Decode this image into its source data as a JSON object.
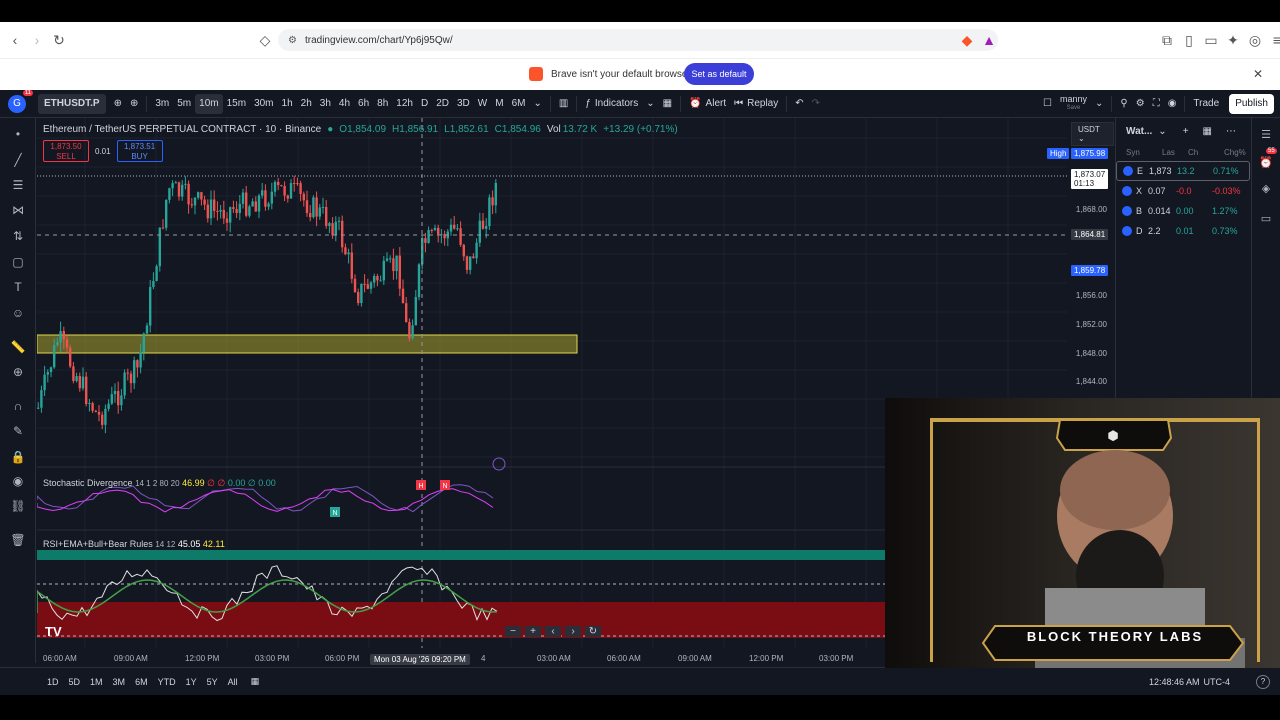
{
  "browser": {
    "url": "tradingview.com/chart/Yp6j95Qw/",
    "banner_message": "Brave isn't your default browser",
    "banner_button": "Set as default"
  },
  "toolbar": {
    "avatar_letter": "G",
    "avatar_badge": "11",
    "symbol": "ETHUSDT.P",
    "intervals": [
      "3m",
      "5m",
      "10m",
      "15m",
      "30m",
      "1h",
      "2h",
      "3h",
      "4h",
      "6h",
      "8h",
      "12h",
      "D",
      "2D",
      "3D",
      "W",
      "M",
      "6M"
    ],
    "active_interval": "10m",
    "indicators": "Indicators",
    "alert": "Alert",
    "replay": "Replay",
    "layout_name": "manny",
    "layout_sub": "Save",
    "trade": "Trade",
    "publish": "Publish"
  },
  "chart": {
    "title": "Ethereum / TetherUS PERPETUAL CONTRACT · 10 · Binance",
    "o": "O1,854.09",
    "h": "H1,856.91",
    "l": "L1,852.61",
    "c": "C1,854.96",
    "vol": "Vol",
    "vol_value": "13.72 K",
    "change": "+13.29 (+0.71%)",
    "sell_price": "1,873.50",
    "sell_label": "SELL",
    "spread": "0.01",
    "buy_price": "1,873.51",
    "buy_label": "BUY",
    "currency": "USDT",
    "high_label": "High",
    "high_value": "1,875.98",
    "last_price": "1,873.07",
    "countdown": "01:13",
    "crosshair_price": "1,864.81",
    "blue_price": "1,859.78",
    "price_ticks": [
      "1,868.00",
      "1,856.00",
      "1,852.00",
      "1,848.00",
      "1,844.00"
    ],
    "time_ticks": [
      "06:00 AM",
      "09:00 AM",
      "12:00 PM",
      "03:00 PM",
      "06:00 PM",
      "4",
      "03:00 AM",
      "06:00 AM",
      "09:00 AM",
      "12:00 PM",
      "03:00 PM"
    ],
    "crosshair_time": "Mon 03 Aug '26   09:20 PM",
    "colors": {
      "up": "#26a69a",
      "down": "#ef5350",
      "zone": "#a7a12a",
      "rsi_upper": "#0d7a6a",
      "rsi_lower": "#7a0d14"
    }
  },
  "stoch": {
    "name": "Stochastic Divergence",
    "params": "14 1 2 80 20",
    "v1": "46.99",
    "v2": "∅",
    "v3": "∅",
    "v4": "0.00",
    "v5": "∅",
    "v6": "0.00",
    "marks": [
      "N",
      "H",
      "N"
    ]
  },
  "rsi": {
    "name": "RSI+EMA+Bull+Bear Rules",
    "params": "14 12",
    "v1": "45.05",
    "v2": "42.11"
  },
  "bottom": {
    "ranges": [
      "1D",
      "5D",
      "1M",
      "3M",
      "6M",
      "YTD",
      "1Y",
      "5Y",
      "All"
    ],
    "clock": "12:48:46 AM",
    "tz": "UTC-4"
  },
  "watchlist": {
    "title": "Wat...",
    "cols": [
      "Syn",
      "Las",
      "Ch",
      "Chg%"
    ],
    "rows": [
      {
        "sym": "E",
        "last": "1,873",
        "ch": "13.2",
        "pct": "0.71%",
        "dir": "up"
      },
      {
        "sym": "X",
        "last": "0.07",
        "ch": "-0.0",
        "pct": "-0.03%",
        "dir": "down"
      },
      {
        "sym": "B",
        "last": "0.014",
        "ch": "0.00",
        "pct": "1.27%",
        "dir": "up"
      },
      {
        "sym": "D",
        "last": "2.2",
        "ch": "0.01",
        "pct": "0.73%",
        "dir": "up"
      }
    ],
    "notif_badge": "55"
  },
  "webcam": {
    "brand": "BLOCK THEORY LABS"
  }
}
